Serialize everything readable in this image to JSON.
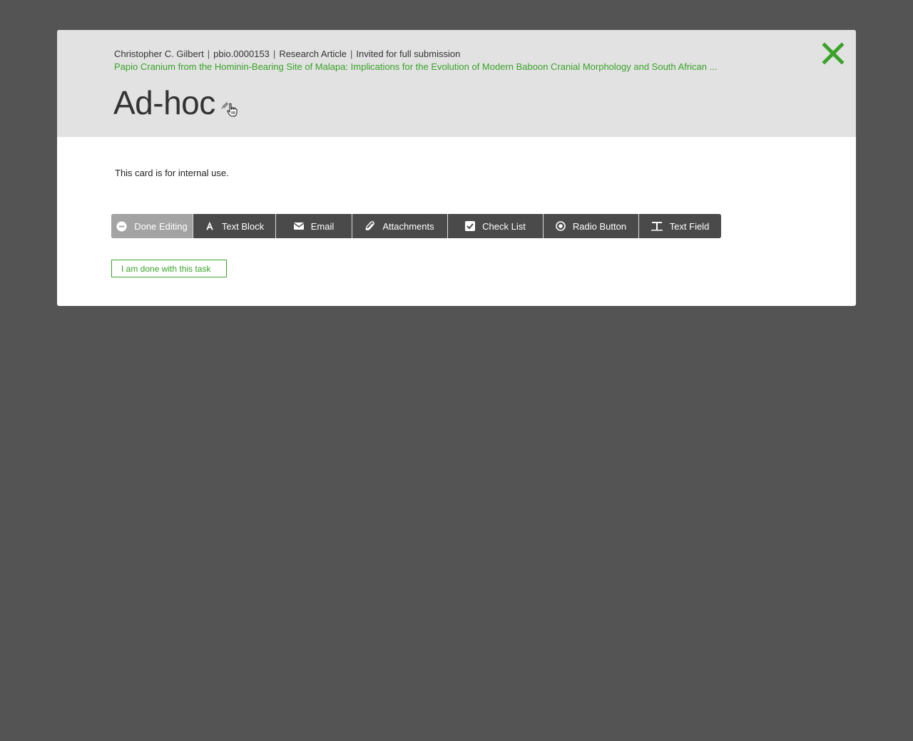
{
  "header": {
    "author": "Christopher C. Gilbert",
    "manuscript_id": "pbio.0000153",
    "article_type": "Research Article",
    "status": "Invited for full submission",
    "separator": "|",
    "paper_title": "Papio Cranium from the Hominin-Bearing Site of Malapa: Implications for the Evolution of Modern Baboon Cranial Morphology and South African ...",
    "card_title": "Ad-hoc",
    "edit_icon": "pencil-icon",
    "close_icon": "close-icon"
  },
  "body": {
    "description": "This card is for internal use."
  },
  "toolbar": {
    "buttons": [
      {
        "label": "Done Editing",
        "icon": "minus-circle-icon",
        "active": true
      },
      {
        "label": "Text Block",
        "icon": "font-icon"
      },
      {
        "label": "Email",
        "icon": "envelope-icon"
      },
      {
        "label": "Attachments",
        "icon": "paperclip-icon"
      },
      {
        "label": "Check List",
        "icon": "checkbox-icon"
      },
      {
        "label": "Radio Button",
        "icon": "radio-icon"
      },
      {
        "label": "Text Field",
        "icon": "text-field-icon"
      }
    ]
  },
  "actions": {
    "done_task_label": "I am done with this task"
  },
  "colors": {
    "accent_green": "#39a329",
    "toolbar_bg": "#4a4a4a",
    "active_bg": "#a3a3a3",
    "backdrop": "#545454",
    "header_bg": "#e2e2e2"
  }
}
